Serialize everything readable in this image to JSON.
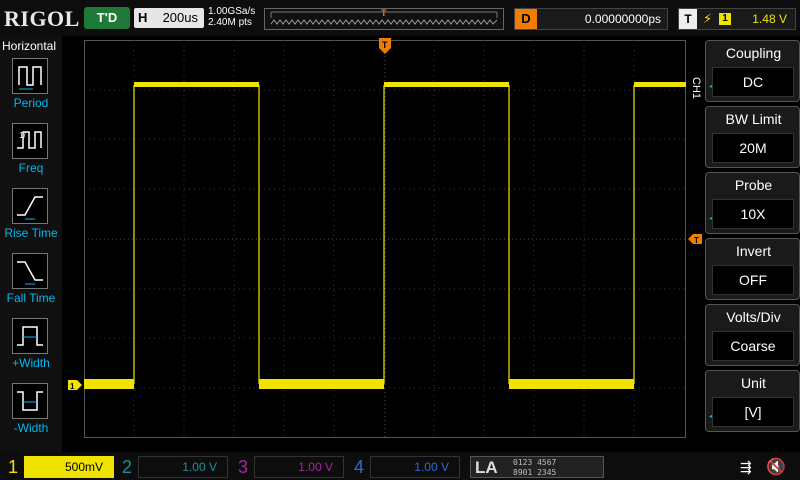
{
  "topbar": {
    "brand": "RIGOL",
    "run_status": "T'D",
    "horizontal_label": "H",
    "timebase": "200us",
    "sample_rate": "1.00GSa/s",
    "memory_depth": "2.40M pts",
    "delay_label": "D",
    "delay_value": "0.00000000ps",
    "trigger_label": "T",
    "trigger_channel": "1",
    "trigger_level": "1.48 V"
  },
  "left_menu": {
    "title": "Horizontal",
    "items": [
      {
        "label": "Period",
        "icon": "period-icon"
      },
      {
        "label": "Freq",
        "icon": "frequency-icon"
      },
      {
        "label": "Rise Time",
        "icon": "rise-time-icon"
      },
      {
        "label": "Fall Time",
        "icon": "fall-time-icon"
      },
      {
        "label": "+Width",
        "icon": "positive-width-icon"
      },
      {
        "label": "-Width",
        "icon": "negative-width-icon"
      }
    ]
  },
  "right_menu": {
    "channel_tag": "CH1",
    "items": [
      {
        "title": "Coupling",
        "value": "DC"
      },
      {
        "title": "BW Limit",
        "value": "20M"
      },
      {
        "title": "Probe",
        "value": "10X"
      },
      {
        "title": "Invert",
        "value": "OFF"
      },
      {
        "title": "Volts/Div",
        "value": "Coarse"
      },
      {
        "title": "Unit",
        "value": "[V]"
      }
    ]
  },
  "bottom_bar": {
    "channels": [
      {
        "num": "1",
        "scale": "500mV"
      },
      {
        "num": "2",
        "scale": "1.00 V"
      },
      {
        "num": "3",
        "scale": "1.00 V"
      },
      {
        "num": "4",
        "scale": "1.00 V"
      }
    ],
    "la_label": "LA",
    "la_digits_row1": "0123 4567",
    "la_digits_row2": "8901 2345"
  },
  "colors": {
    "ch1": "#f0e300",
    "ch2": "#1f8f9a",
    "ch3": "#a02b9a",
    "ch4": "#2e6ad6",
    "menu_accent": "#00b7ef",
    "trigger_marker": "#f07d00"
  }
}
